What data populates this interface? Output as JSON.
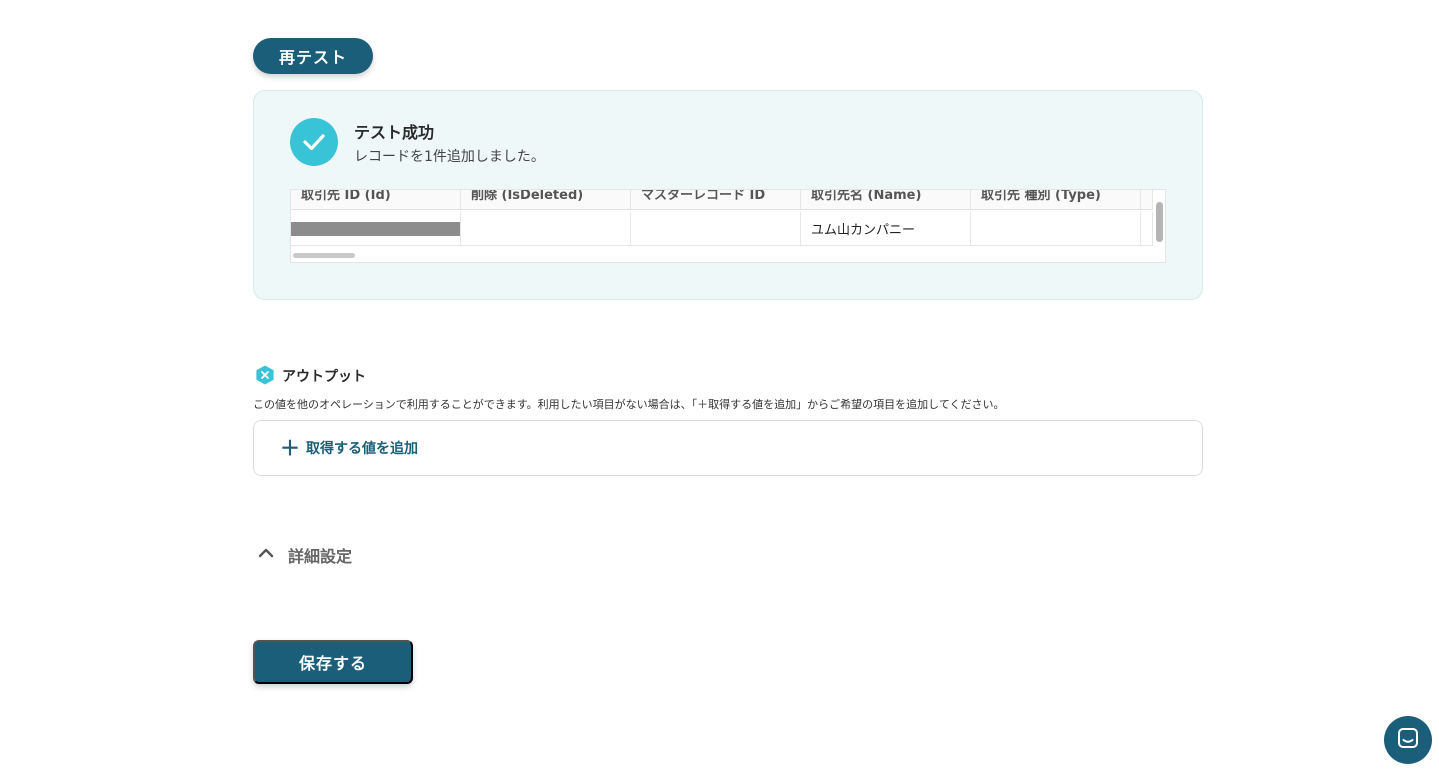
{
  "buttons": {
    "retest": "再テスト",
    "save": "保存する"
  },
  "test_result": {
    "title": "テスト成功",
    "message": "レコードを1件追加しました。",
    "table": {
      "headers": [
        "取引先 ID (Id)",
        "削除 (IsDeleted)",
        "マスターレコード ID",
        "取引先名 (Name)",
        "取引先 種別 (Type)"
      ],
      "rows": [
        [
          "",
          "",
          "",
          "ユム山カンパニー",
          ""
        ]
      ]
    }
  },
  "output": {
    "title": "アウトプット",
    "description": "この値を他のオペレーションで利用することができます。利用したい項目がない場合は、「＋取得する値を追加」からご希望の項目を追加してください。",
    "add_label": "取得する値を追加"
  },
  "advanced": {
    "label": "詳細設定"
  },
  "colors": {
    "primary": "#1a5e7a",
    "success": "#39c3d6",
    "panel_bg": "#eef8f8"
  },
  "icons": [
    "check-icon",
    "output-x-icon",
    "plus-icon",
    "chevron-up-icon",
    "chat-icon"
  ]
}
